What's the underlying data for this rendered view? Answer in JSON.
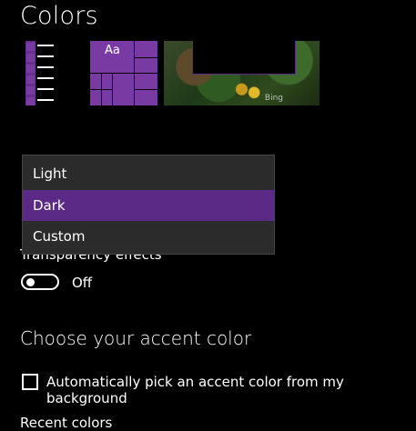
{
  "page": {
    "title": "Colors"
  },
  "preview": {
    "tiles_label": "Aa",
    "wallpaper_watermark": "Bing"
  },
  "mode_dropdown": {
    "options": [
      "Light",
      "Dark",
      "Custom"
    ],
    "selected": "Dark",
    "selected_color": "#5b2a86"
  },
  "transparency": {
    "label": "Transparency effects",
    "state": "Off"
  },
  "accent": {
    "heading": "Choose your accent color",
    "auto_pick_label": "Automatically pick an accent color from my background",
    "recent_colors_label": "Recent colors"
  },
  "colors": {
    "accent": "#7a3aa3",
    "background": "#000000"
  }
}
